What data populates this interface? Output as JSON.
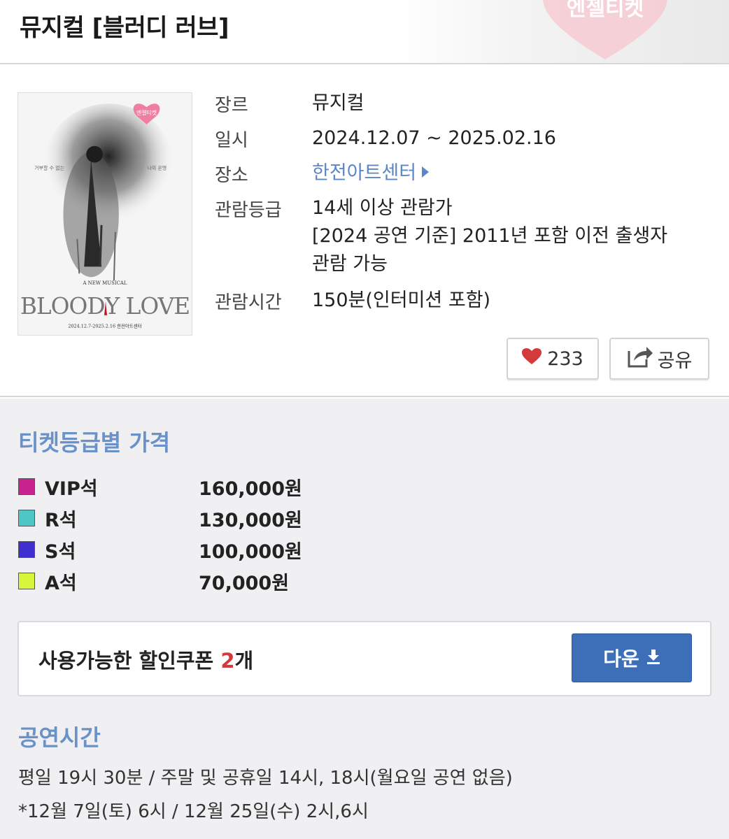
{
  "header": {
    "title": "뮤지컬 [블러디 러브]",
    "logo_text": "엔젤티켓"
  },
  "poster": {
    "logo_text": "엔젤티켓",
    "left_caption": "거부할 수 없는",
    "right_caption": "나의 운명",
    "subtitle": "A NEW MUSICAL",
    "title": "BLOODY LOVE",
    "footer": "2024.12.7-2025.2.16 한전아트센터"
  },
  "info": {
    "genre_label": "장르",
    "genre_value": "뮤지컬",
    "date_label": "일시",
    "date_value": "2024.12.07 ~ 2025.02.16",
    "venue_label": "장소",
    "venue_value": "한전아트센터",
    "rating_label": "관람등급",
    "rating_line1": "14세 이상 관람가",
    "rating_line2": "[2024 공연 기준] 2011년 포함 이전 출생자",
    "rating_line3": "관람 가능",
    "runtime_label": "관람시간",
    "runtime_value": "150분(인터미션 포함)"
  },
  "actions": {
    "like_count": "233",
    "share_label": "공유"
  },
  "pricing": {
    "title": "티켓등급별 가격",
    "grades": [
      {
        "name": "VIP석",
        "price": "160,000원",
        "color": "#c8238f"
      },
      {
        "name": "R석",
        "price": "130,000원",
        "color": "#4fc6c6"
      },
      {
        "name": "S석",
        "price": "100,000원",
        "color": "#3f2fd0"
      },
      {
        "name": "A석",
        "price": "70,000원",
        "color": "#d7f53b"
      }
    ]
  },
  "coupon": {
    "text": "사용가능한 할인쿠폰 ",
    "count": "2",
    "unit": "개",
    "download_label": "다운"
  },
  "showtime": {
    "title": "공연시간",
    "line1": "평일 19시 30분 / 주말 및 공휴일 14시, 18시(월요일 공연 없음)",
    "line2": "*12월 7일(토) 6시 / 12월 25일(수) 2시,6시"
  },
  "colors": {
    "accent": "#6a92c9",
    "button": "#3c6fb8",
    "like": "#d33b3b"
  }
}
